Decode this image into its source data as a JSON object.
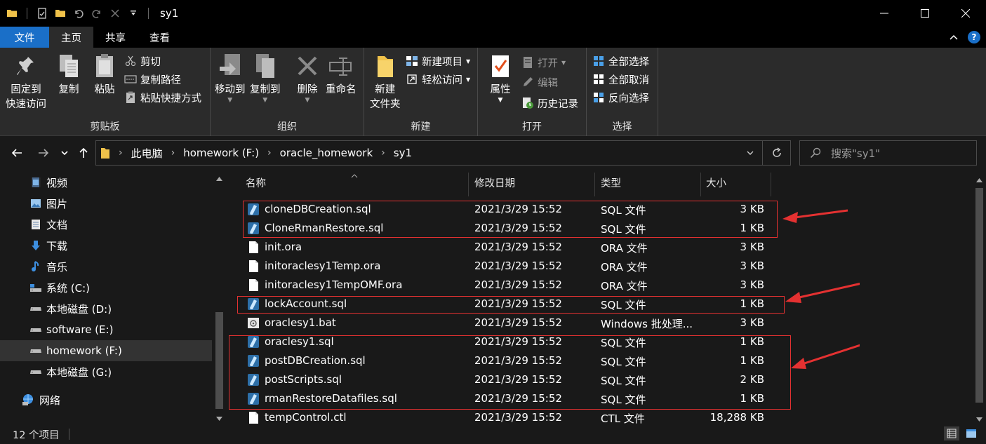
{
  "window": {
    "title": "sy1",
    "minimize": "—",
    "maximize": "☐",
    "close": "✕"
  },
  "ribbon_tabs": {
    "file": "文件",
    "home": "主页",
    "share": "共享",
    "view": "查看"
  },
  "ribbon": {
    "clipboard": {
      "label": "剪贴板",
      "pin_line1": "固定到",
      "pin_line2": "快速访问",
      "copy": "复制",
      "paste": "粘贴",
      "cut": "剪切",
      "copy_path": "复制路径",
      "paste_shortcut": "粘贴快捷方式"
    },
    "organize": {
      "label": "组织",
      "move_to": "移动到",
      "copy_to": "复制到",
      "delete": "删除",
      "rename": "重命名"
    },
    "new": {
      "label": "新建",
      "new_folder_line1": "新建",
      "new_folder_line2": "文件夹",
      "new_item": "新建项目",
      "easy_access": "轻松访问"
    },
    "open": {
      "label": "打开",
      "properties": "属性",
      "open": "打开",
      "edit": "编辑",
      "history": "历史记录"
    },
    "select": {
      "label": "选择",
      "select_all": "全部选择",
      "select_none": "全部取消",
      "invert": "反向选择"
    }
  },
  "address": {
    "crumbs": [
      "此电脑",
      "homework (F:)",
      "oracle_homework",
      "sy1"
    ],
    "search_placeholder": "搜索\"sy1\""
  },
  "sidebar": {
    "items": [
      {
        "label": "视频",
        "icon": "video-icon"
      },
      {
        "label": "图片",
        "icon": "pictures-icon"
      },
      {
        "label": "文档",
        "icon": "documents-icon"
      },
      {
        "label": "下载",
        "icon": "download-icon"
      },
      {
        "label": "音乐",
        "icon": "music-icon"
      },
      {
        "label": "系统 (C:)",
        "icon": "system-drive-icon"
      },
      {
        "label": "本地磁盘 (D:)",
        "icon": "drive-icon"
      },
      {
        "label": "software (E:)",
        "icon": "drive-icon"
      },
      {
        "label": "homework (F:)",
        "icon": "drive-icon",
        "selected": true
      },
      {
        "label": "本地磁盘 (G:)",
        "icon": "drive-icon"
      },
      {
        "label": "网络",
        "icon": "network-icon"
      }
    ]
  },
  "columns": {
    "name": "名称",
    "modified": "修改日期",
    "type": "类型",
    "size": "大小"
  },
  "files": [
    {
      "name": "cloneDBCreation.sql",
      "modified": "2021/3/29 15:52",
      "type": "SQL 文件",
      "size": "3 KB",
      "kind": "sql"
    },
    {
      "name": "CloneRmanRestore.sql",
      "modified": "2021/3/29 15:52",
      "type": "SQL 文件",
      "size": "1 KB",
      "kind": "sql"
    },
    {
      "name": "init.ora",
      "modified": "2021/3/29 15:52",
      "type": "ORA 文件",
      "size": "3 KB",
      "kind": "blank"
    },
    {
      "name": "initoraclesy1Temp.ora",
      "modified": "2021/3/29 15:52",
      "type": "ORA 文件",
      "size": "3 KB",
      "kind": "blank"
    },
    {
      "name": "initoraclesy1TempOMF.ora",
      "modified": "2021/3/29 15:52",
      "type": "ORA 文件",
      "size": "3 KB",
      "kind": "blank"
    },
    {
      "name": "lockAccount.sql",
      "modified": "2021/3/29 15:52",
      "type": "SQL 文件",
      "size": "1 KB",
      "kind": "sql"
    },
    {
      "name": "oraclesy1.bat",
      "modified": "2021/3/29 15:52",
      "type": "Windows 批处理...",
      "size": "3 KB",
      "kind": "bat"
    },
    {
      "name": "oraclesy1.sql",
      "modified": "2021/3/29 15:52",
      "type": "SQL 文件",
      "size": "1 KB",
      "kind": "sql"
    },
    {
      "name": "postDBCreation.sql",
      "modified": "2021/3/29 15:52",
      "type": "SQL 文件",
      "size": "1 KB",
      "kind": "sql"
    },
    {
      "name": "postScripts.sql",
      "modified": "2021/3/29 15:52",
      "type": "SQL 文件",
      "size": "2 KB",
      "kind": "sql"
    },
    {
      "name": "rmanRestoreDatafiles.sql",
      "modified": "2021/3/29 15:52",
      "type": "SQL 文件",
      "size": "1 KB",
      "kind": "sql"
    },
    {
      "name": "tempControl.ctl",
      "modified": "2021/3/29 15:52",
      "type": "CTL 文件",
      "size": "18,288 KB",
      "kind": "blank"
    }
  ],
  "status": {
    "count": "12 个项目"
  },
  "colors": {
    "accent": "#1a6fc8",
    "annotation": "#e43131"
  }
}
